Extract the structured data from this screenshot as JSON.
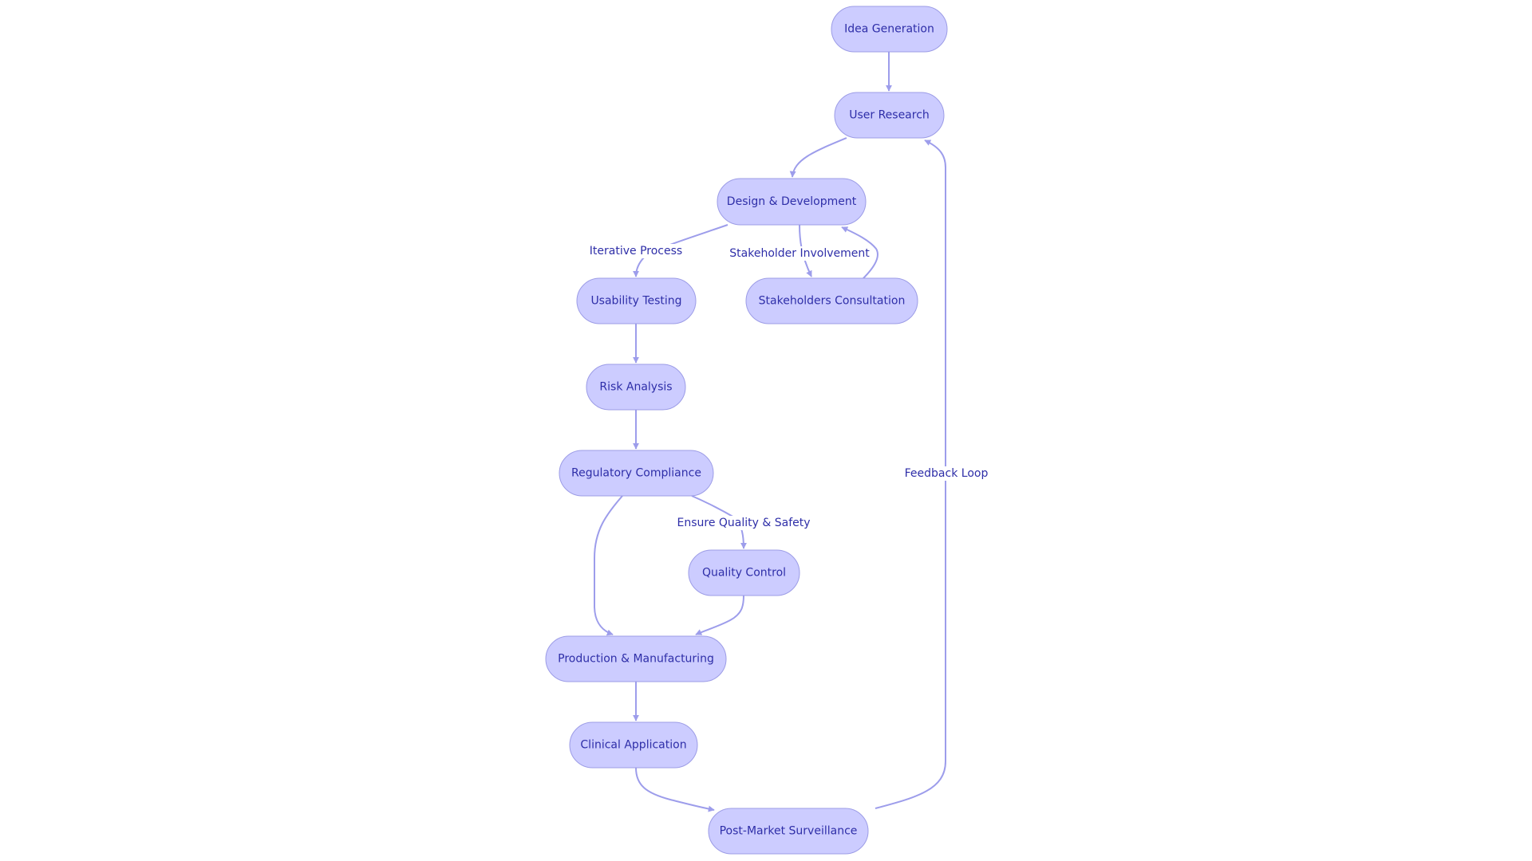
{
  "diagram": {
    "type": "flowchart",
    "direction": "top-down",
    "colors": {
      "node_fill": "#ccccff",
      "node_border": "#9c9ce6",
      "text": "#2e2ea8",
      "edge": "#9d9deb",
      "background": "#ffffff"
    },
    "nodes": [
      {
        "id": "idea",
        "label": "Idea Generation"
      },
      {
        "id": "research",
        "label": "User Research"
      },
      {
        "id": "design",
        "label": "Design & Development"
      },
      {
        "id": "usability",
        "label": "Usability Testing"
      },
      {
        "id": "stakeholders",
        "label": "Stakeholders Consultation"
      },
      {
        "id": "risk",
        "label": "Risk Analysis"
      },
      {
        "id": "regulatory",
        "label": "Regulatory Compliance"
      },
      {
        "id": "quality",
        "label": "Quality Control"
      },
      {
        "id": "production",
        "label": "Production & Manufacturing"
      },
      {
        "id": "clinical",
        "label": "Clinical Application"
      },
      {
        "id": "postmarket",
        "label": "Post-Market Surveillance"
      }
    ],
    "edges": [
      {
        "from": "idea",
        "to": "research",
        "label": ""
      },
      {
        "from": "research",
        "to": "design",
        "label": ""
      },
      {
        "from": "design",
        "to": "usability",
        "label": "Iterative Process"
      },
      {
        "from": "design",
        "to": "stakeholders",
        "label": "Stakeholder Involvement"
      },
      {
        "from": "stakeholders",
        "to": "design",
        "label": ""
      },
      {
        "from": "usability",
        "to": "risk",
        "label": ""
      },
      {
        "from": "risk",
        "to": "regulatory",
        "label": ""
      },
      {
        "from": "regulatory",
        "to": "quality",
        "label": "Ensure Quality & Safety"
      },
      {
        "from": "regulatory",
        "to": "production",
        "label": ""
      },
      {
        "from": "quality",
        "to": "production",
        "label": ""
      },
      {
        "from": "production",
        "to": "clinical",
        "label": ""
      },
      {
        "from": "clinical",
        "to": "postmarket",
        "label": ""
      },
      {
        "from": "postmarket",
        "to": "research",
        "label": "Feedback Loop"
      }
    ]
  }
}
